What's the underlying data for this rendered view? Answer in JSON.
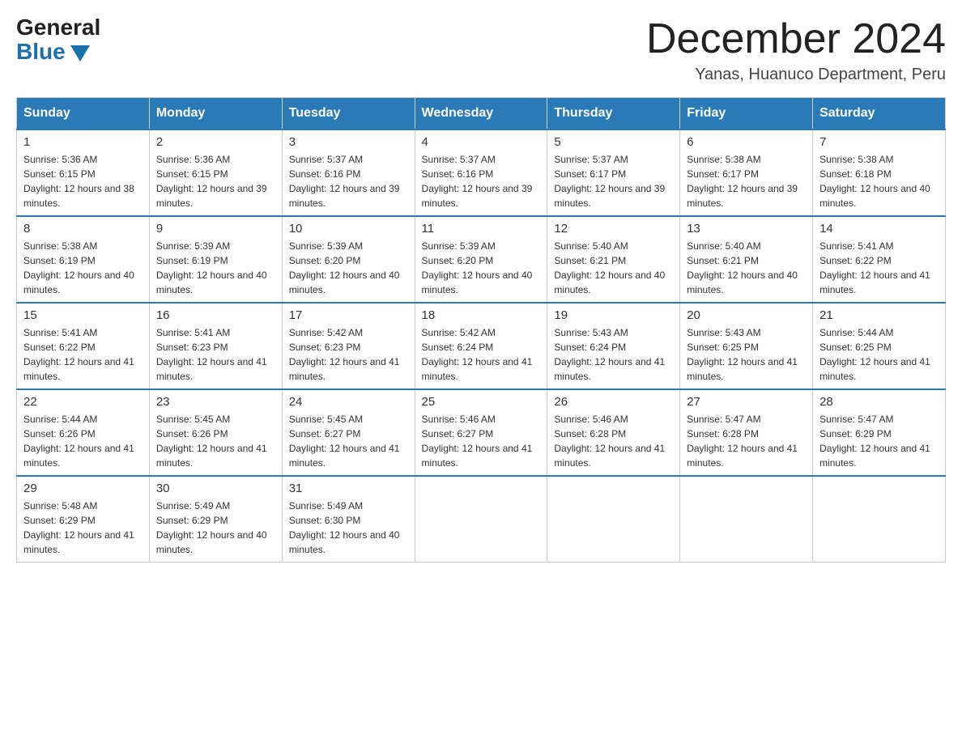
{
  "header": {
    "logo_general": "General",
    "logo_blue": "Blue",
    "title": "December 2024",
    "subtitle": "Yanas, Huanuco Department, Peru"
  },
  "calendar": {
    "days_of_week": [
      "Sunday",
      "Monday",
      "Tuesday",
      "Wednesday",
      "Thursday",
      "Friday",
      "Saturday"
    ],
    "weeks": [
      [
        {
          "day": "1",
          "sunrise": "5:36 AM",
          "sunset": "6:15 PM",
          "daylight": "12 hours and 38 minutes."
        },
        {
          "day": "2",
          "sunrise": "5:36 AM",
          "sunset": "6:15 PM",
          "daylight": "12 hours and 39 minutes."
        },
        {
          "day": "3",
          "sunrise": "5:37 AM",
          "sunset": "6:16 PM",
          "daylight": "12 hours and 39 minutes."
        },
        {
          "day": "4",
          "sunrise": "5:37 AM",
          "sunset": "6:16 PM",
          "daylight": "12 hours and 39 minutes."
        },
        {
          "day": "5",
          "sunrise": "5:37 AM",
          "sunset": "6:17 PM",
          "daylight": "12 hours and 39 minutes."
        },
        {
          "day": "6",
          "sunrise": "5:38 AM",
          "sunset": "6:17 PM",
          "daylight": "12 hours and 39 minutes."
        },
        {
          "day": "7",
          "sunrise": "5:38 AM",
          "sunset": "6:18 PM",
          "daylight": "12 hours and 40 minutes."
        }
      ],
      [
        {
          "day": "8",
          "sunrise": "5:38 AM",
          "sunset": "6:19 PM",
          "daylight": "12 hours and 40 minutes."
        },
        {
          "day": "9",
          "sunrise": "5:39 AM",
          "sunset": "6:19 PM",
          "daylight": "12 hours and 40 minutes."
        },
        {
          "day": "10",
          "sunrise": "5:39 AM",
          "sunset": "6:20 PM",
          "daylight": "12 hours and 40 minutes."
        },
        {
          "day": "11",
          "sunrise": "5:39 AM",
          "sunset": "6:20 PM",
          "daylight": "12 hours and 40 minutes."
        },
        {
          "day": "12",
          "sunrise": "5:40 AM",
          "sunset": "6:21 PM",
          "daylight": "12 hours and 40 minutes."
        },
        {
          "day": "13",
          "sunrise": "5:40 AM",
          "sunset": "6:21 PM",
          "daylight": "12 hours and 40 minutes."
        },
        {
          "day": "14",
          "sunrise": "5:41 AM",
          "sunset": "6:22 PM",
          "daylight": "12 hours and 41 minutes."
        }
      ],
      [
        {
          "day": "15",
          "sunrise": "5:41 AM",
          "sunset": "6:22 PM",
          "daylight": "12 hours and 41 minutes."
        },
        {
          "day": "16",
          "sunrise": "5:41 AM",
          "sunset": "6:23 PM",
          "daylight": "12 hours and 41 minutes."
        },
        {
          "day": "17",
          "sunrise": "5:42 AM",
          "sunset": "6:23 PM",
          "daylight": "12 hours and 41 minutes."
        },
        {
          "day": "18",
          "sunrise": "5:42 AM",
          "sunset": "6:24 PM",
          "daylight": "12 hours and 41 minutes."
        },
        {
          "day": "19",
          "sunrise": "5:43 AM",
          "sunset": "6:24 PM",
          "daylight": "12 hours and 41 minutes."
        },
        {
          "day": "20",
          "sunrise": "5:43 AM",
          "sunset": "6:25 PM",
          "daylight": "12 hours and 41 minutes."
        },
        {
          "day": "21",
          "sunrise": "5:44 AM",
          "sunset": "6:25 PM",
          "daylight": "12 hours and 41 minutes."
        }
      ],
      [
        {
          "day": "22",
          "sunrise": "5:44 AM",
          "sunset": "6:26 PM",
          "daylight": "12 hours and 41 minutes."
        },
        {
          "day": "23",
          "sunrise": "5:45 AM",
          "sunset": "6:26 PM",
          "daylight": "12 hours and 41 minutes."
        },
        {
          "day": "24",
          "sunrise": "5:45 AM",
          "sunset": "6:27 PM",
          "daylight": "12 hours and 41 minutes."
        },
        {
          "day": "25",
          "sunrise": "5:46 AM",
          "sunset": "6:27 PM",
          "daylight": "12 hours and 41 minutes."
        },
        {
          "day": "26",
          "sunrise": "5:46 AM",
          "sunset": "6:28 PM",
          "daylight": "12 hours and 41 minutes."
        },
        {
          "day": "27",
          "sunrise": "5:47 AM",
          "sunset": "6:28 PM",
          "daylight": "12 hours and 41 minutes."
        },
        {
          "day": "28",
          "sunrise": "5:47 AM",
          "sunset": "6:29 PM",
          "daylight": "12 hours and 41 minutes."
        }
      ],
      [
        {
          "day": "29",
          "sunrise": "5:48 AM",
          "sunset": "6:29 PM",
          "daylight": "12 hours and 41 minutes."
        },
        {
          "day": "30",
          "sunrise": "5:49 AM",
          "sunset": "6:29 PM",
          "daylight": "12 hours and 40 minutes."
        },
        {
          "day": "31",
          "sunrise": "5:49 AM",
          "sunset": "6:30 PM",
          "daylight": "12 hours and 40 minutes."
        },
        null,
        null,
        null,
        null
      ]
    ]
  }
}
